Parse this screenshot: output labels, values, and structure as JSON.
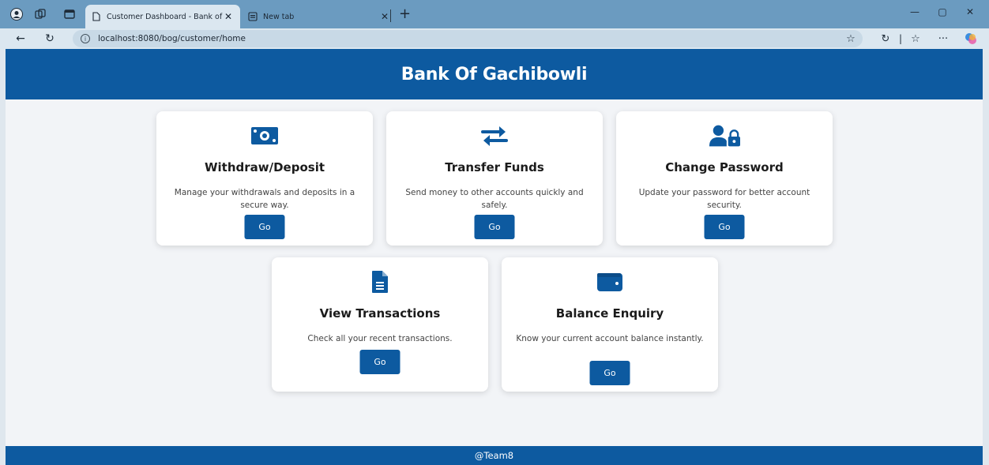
{
  "browser": {
    "tabs": [
      {
        "title": "Customer Dashboard - Bank of G",
        "active": true
      },
      {
        "title": "New tab",
        "active": false
      }
    ],
    "url": "localhost:8080/bog/customer/home"
  },
  "header": {
    "title": "Bank Of Gachibowli"
  },
  "cards": [
    {
      "icon": "money-bill-icon",
      "title": "Withdraw/Deposit",
      "description": "Manage your withdrawals and deposits in a secure way.",
      "button": "Go"
    },
    {
      "icon": "transfer-arrows-icon",
      "title": "Transfer Funds",
      "description": "Send money to other accounts quickly and safely.",
      "button": "Go"
    },
    {
      "icon": "user-lock-icon",
      "title": "Change Password",
      "description": "Update your password for better account security.",
      "button": "Go"
    },
    {
      "icon": "document-icon",
      "title": "View Transactions",
      "description": "Check all your recent transactions.",
      "button": "Go"
    },
    {
      "icon": "wallet-icon",
      "title": "Balance Enquiry",
      "description": "Know your current account balance instantly.",
      "button": "Go"
    }
  ],
  "footer": {
    "text": "@Team8"
  },
  "colors": {
    "brand": "#0d5aa0",
    "page_bg": "#f2f4f7",
    "tab_strip": "#6b9bc0"
  }
}
